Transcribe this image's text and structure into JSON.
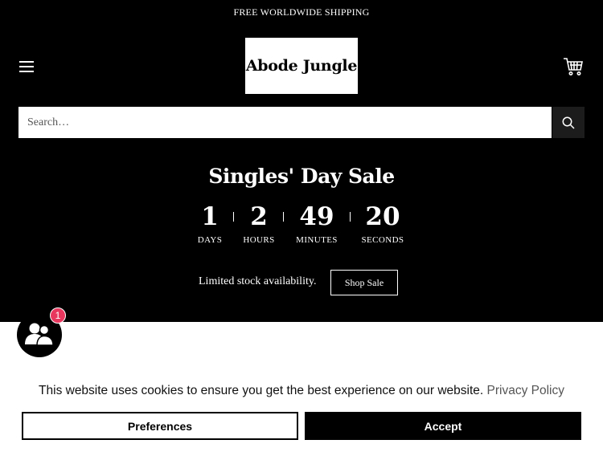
{
  "announcement": "FREE WORLDWIDE SHIPPING",
  "logo_text": "Abode Jungle",
  "icons": {
    "menu": "hamburger-menu-icon",
    "cart": "shopping-cart-icon",
    "search": "magnifier-search-icon",
    "chat": "people-chat-icon"
  },
  "search": {
    "placeholder": "Search…"
  },
  "sale": {
    "title": "Singles' Day Sale",
    "countdown": [
      {
        "value": "1",
        "label": "DAYS"
      },
      {
        "value": "2",
        "label": "HOURS"
      },
      {
        "value": "49",
        "label": "MINUTES"
      },
      {
        "value": "20",
        "label": "SECONDS"
      }
    ],
    "stock_text": "Limited stock availability.",
    "shop_button": "Shop Sale"
  },
  "chat": {
    "badge_count": "1"
  },
  "cookie": {
    "message": "This website uses cookies to ensure you get the best experience on our website.",
    "policy_link": "Privacy Policy",
    "preferences_button": "Preferences",
    "accept_button": "Accept"
  },
  "colors": {
    "header_background": "#000000",
    "badge": "#e8375e",
    "link": "#555555"
  }
}
